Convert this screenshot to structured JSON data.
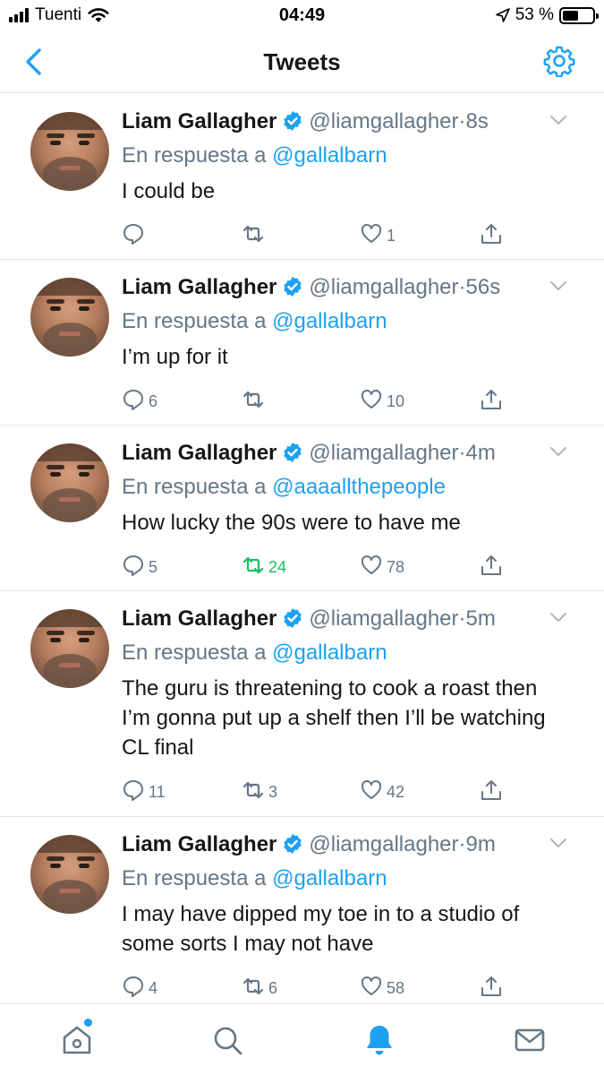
{
  "status_bar": {
    "carrier": "Tuenti",
    "time": "04:49",
    "battery_label": "53 %",
    "battery_level": 0.53
  },
  "nav": {
    "title": "Tweets",
    "back_icon": "chevron-left-icon",
    "settings_icon": "gear-icon"
  },
  "colors": {
    "accent": "#1da1f2",
    "muted": "#657786",
    "text": "#14171a",
    "retweet_active": "#17bf63",
    "divider": "#e1e8ed"
  },
  "tweets": [
    {
      "name": "Liam Gallagher",
      "handle": "@liamgallagher",
      "separator": "·",
      "time": "8s",
      "reply_prefix": "En respuesta a",
      "reply_to": "@gallalbarn",
      "text": "I could be",
      "replies": "",
      "retweets": "",
      "likes": "1",
      "retweeted": false
    },
    {
      "name": "Liam Gallagher",
      "handle": "@liamgallagher",
      "separator": "·",
      "time": "56s",
      "reply_prefix": "En respuesta a",
      "reply_to": "@gallalbarn",
      "text": "I’m up for it",
      "replies": "6",
      "retweets": "",
      "likes": "10",
      "retweeted": false
    },
    {
      "name": "Liam Gallagher",
      "handle": "@liamgallagher",
      "separator": "·",
      "time": "4m",
      "reply_prefix": "En respuesta a",
      "reply_to": "@aaaallthepeople",
      "text": "How lucky the 90s were to have me",
      "replies": "5",
      "retweets": "24",
      "likes": "78",
      "retweeted": true
    },
    {
      "name": "Liam Gallagher",
      "handle": "@liamgallagher",
      "separator": "·",
      "time": "5m",
      "reply_prefix": "En respuesta a",
      "reply_to": "@gallalbarn",
      "text": "The guru is threatening to cook a roast then I’m gonna put up a shelf then I’ll be watching CL final",
      "replies": "11",
      "retweets": "3",
      "likes": "42",
      "retweeted": false
    },
    {
      "name": "Liam Gallagher",
      "handle": "@liamgallagher",
      "separator": "·",
      "time": "9m",
      "reply_prefix": "En respuesta a",
      "reply_to": "@gallalbarn",
      "text": "I may have dipped my toe in to a studio of some sorts I may not have",
      "replies": "4",
      "retweets": "6",
      "likes": "58",
      "retweeted": false
    }
  ],
  "tab_bar": {
    "items": [
      "home-icon",
      "search-icon",
      "notifications-bell-icon",
      "messages-envelope-icon"
    ],
    "active": "notifications-bell-icon",
    "home_has_new_dot": true
  }
}
